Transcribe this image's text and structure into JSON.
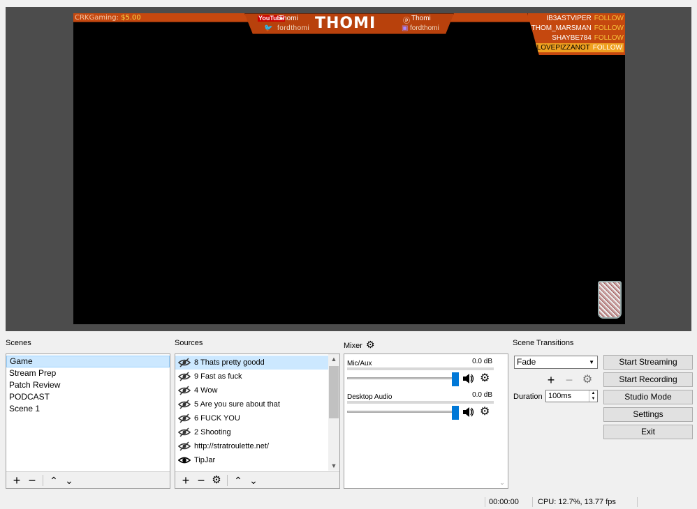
{
  "preview": {
    "donation_label": "CRKGaming:",
    "donation_amount": "$5.00",
    "youtube_tag": "YouTube",
    "youtube_name": "Thomi",
    "twitter_name": "fordthomi",
    "brand": "THOMI",
    "patreon_name": "Thomi",
    "twitch_name": "fordthomi",
    "followers": [
      {
        "name": "IB3ASTVIPER",
        "tag": "FOLLOW"
      },
      {
        "name": "THOM_MARSMAN",
        "tag": "FOLLOW"
      },
      {
        "name": "SHAYBE784",
        "tag": "FOLLOW"
      },
      {
        "name": "ILOVEPIZZANOT",
        "tag": "FOLLOW"
      }
    ]
  },
  "scenes": {
    "title": "Scenes",
    "items": [
      "Game",
      "Stream Prep",
      "Patch Review",
      "PODCAST",
      "Scene 1"
    ],
    "selected": "Game"
  },
  "sources": {
    "title": "Sources",
    "items": [
      {
        "label": "8 Thats pretty goodd",
        "visible": false
      },
      {
        "label": "9 Fast as fuck",
        "visible": false
      },
      {
        "label": "4 Wow",
        "visible": false
      },
      {
        "label": "5 Are you sure about that",
        "visible": false
      },
      {
        "label": "6 FUCK YOU",
        "visible": false
      },
      {
        "label": "2 Shooting",
        "visible": false
      },
      {
        "label": "http://stratroulette.net/",
        "visible": false
      },
      {
        "label": "TipJar",
        "visible": true
      }
    ]
  },
  "mixer": {
    "title": "Mixer",
    "channels": [
      {
        "name": "Mic/Aux",
        "db": "0.0 dB"
      },
      {
        "name": "Desktop Audio",
        "db": "0.0 dB"
      }
    ]
  },
  "transitions": {
    "title": "Scene Transitions",
    "selected": "Fade",
    "duration_label": "Duration",
    "duration_value": "100ms"
  },
  "controls": {
    "start_streaming": "Start Streaming",
    "start_recording": "Start Recording",
    "studio_mode": "Studio Mode",
    "settings": "Settings",
    "exit": "Exit"
  },
  "status": {
    "time": "00:00:00",
    "cpu": "CPU: 12.7%, 13.77 fps"
  },
  "colors": {
    "overlay_orange": "#c5480f",
    "selection": "#cce8ff",
    "slider_handle": "#0078d7"
  }
}
